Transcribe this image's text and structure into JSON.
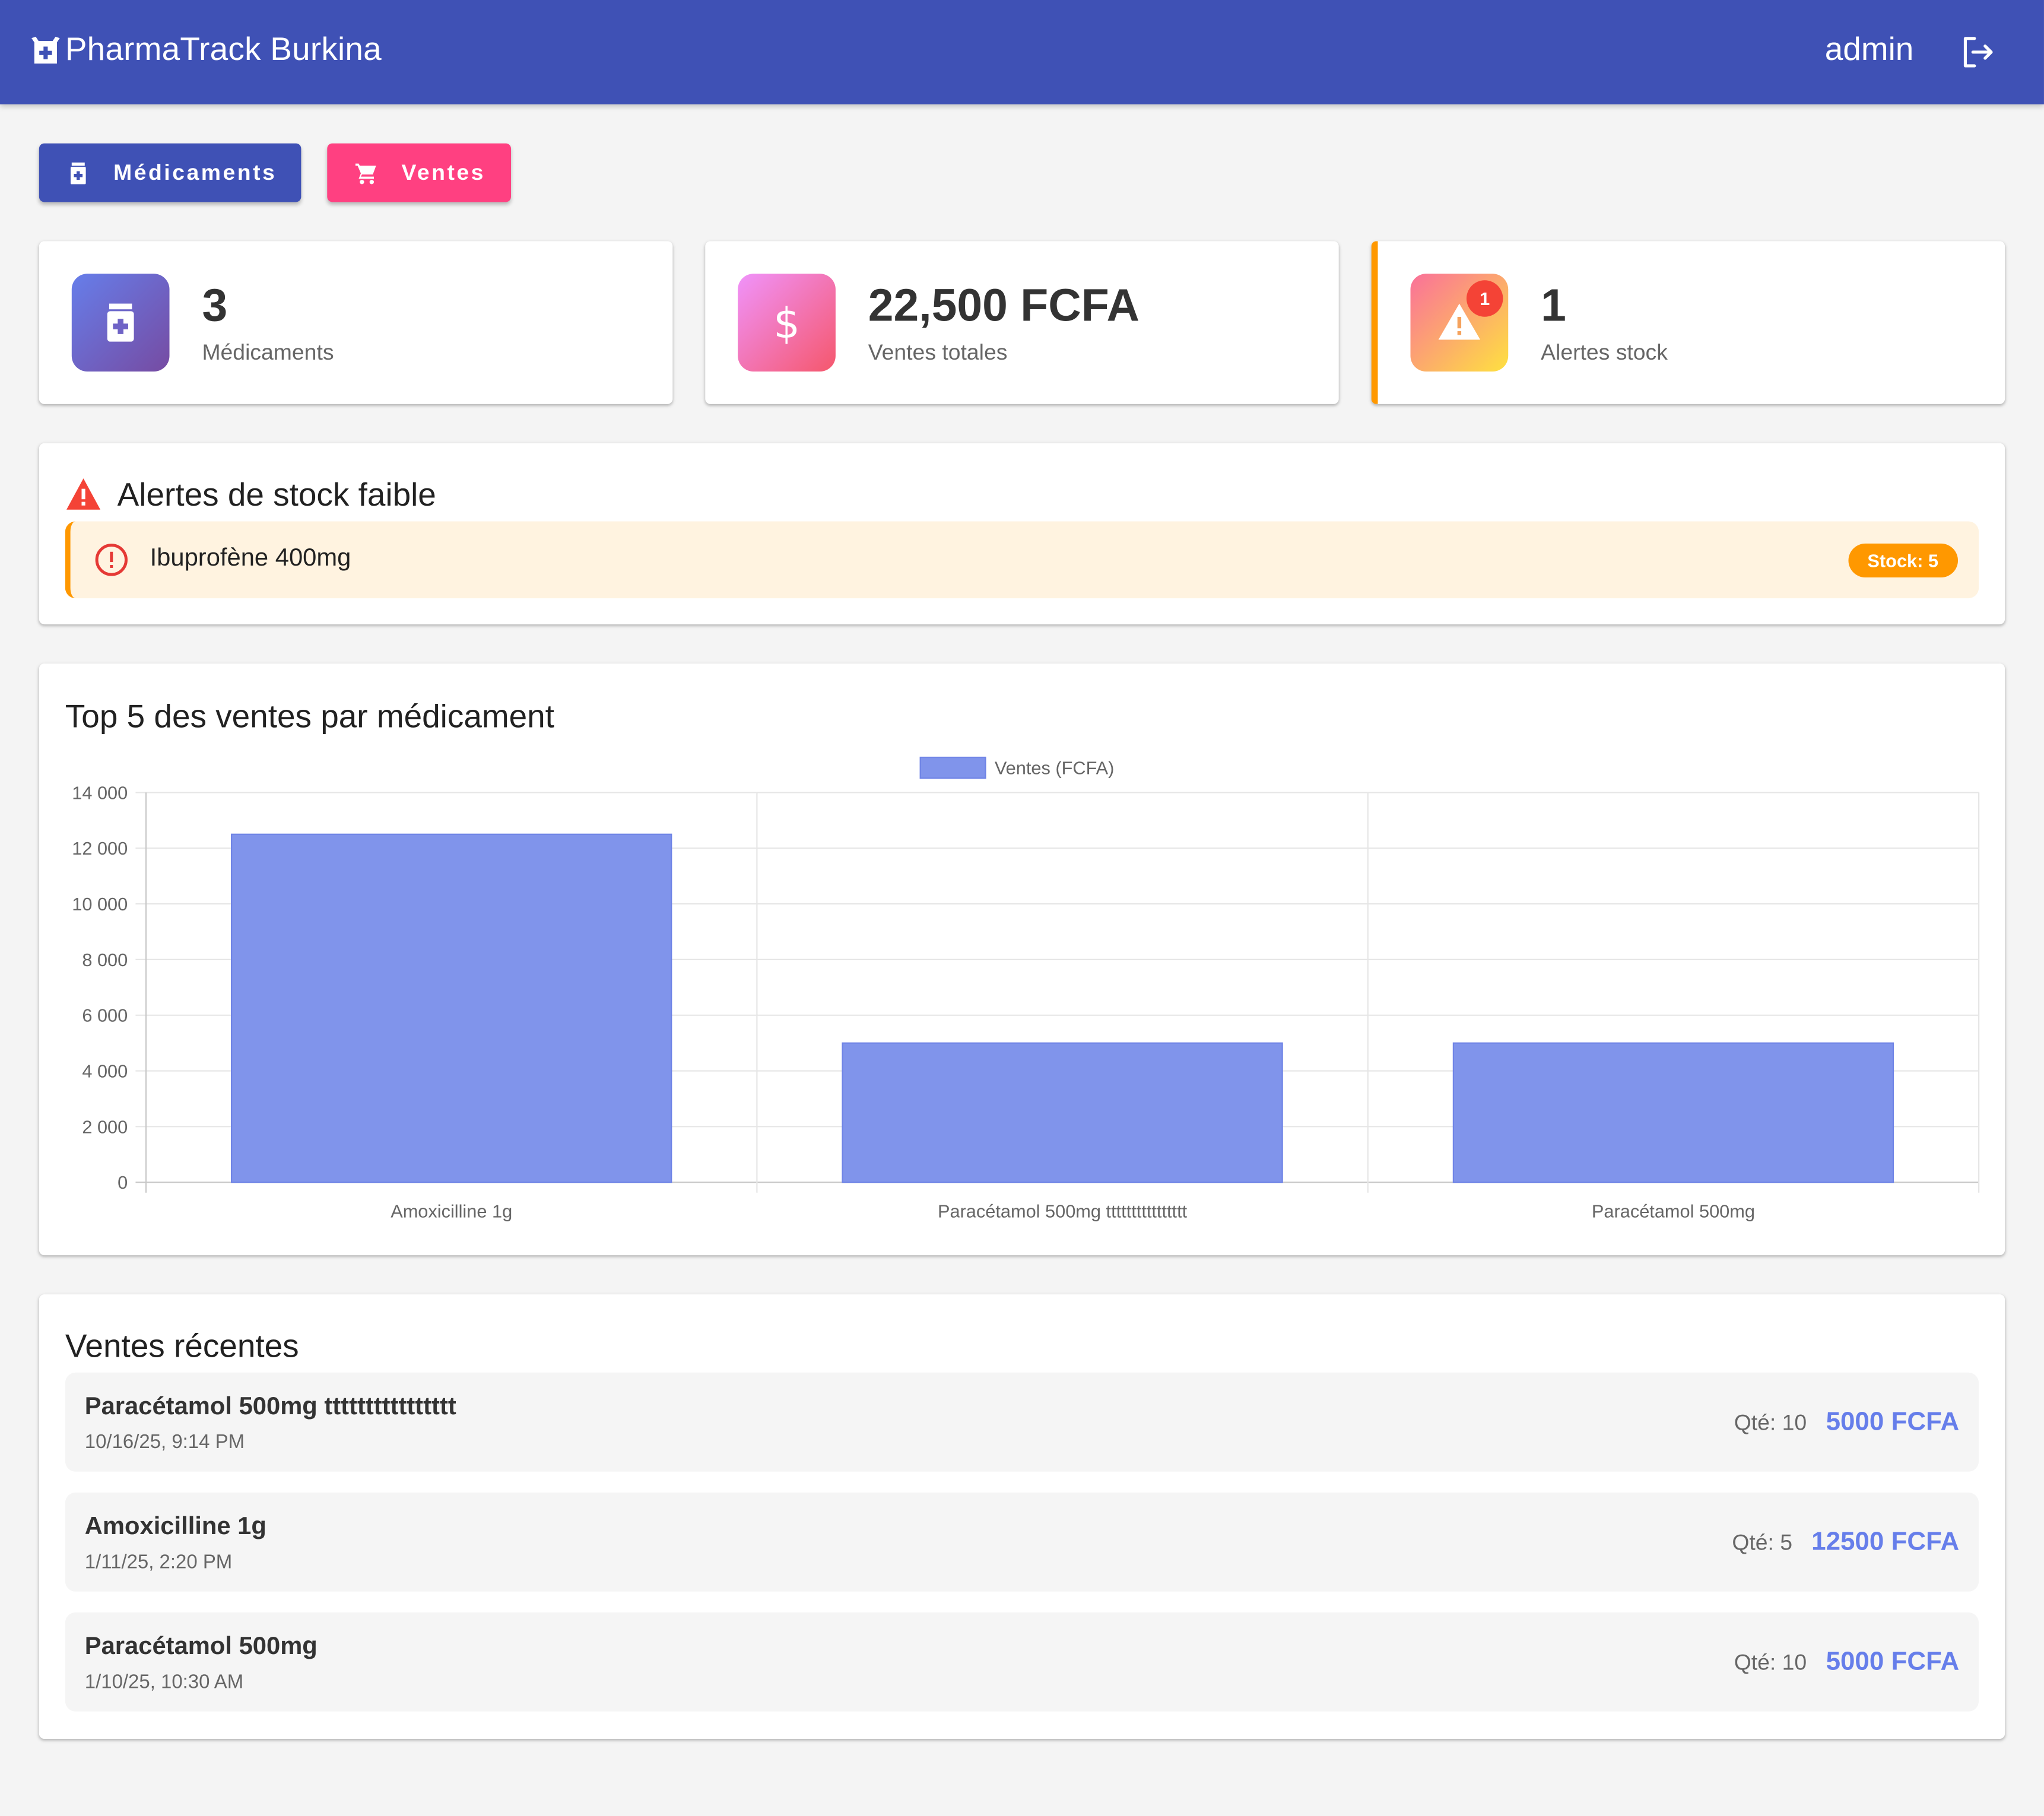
{
  "appbar": {
    "title": "PharmaTrack Burkina",
    "user": "admin",
    "logo_icon": "medication-icon",
    "logout_icon": "logout-icon",
    "color": "#3f51b5"
  },
  "nav": {
    "medicaments_label": "Médicaments",
    "ventes_label": "Ventes",
    "medicaments_color": "#3f51b5",
    "ventes_color": "#ff4081"
  },
  "stats": [
    {
      "value": "3",
      "label": "Médicaments",
      "icon": "medication-icon"
    },
    {
      "value": "22,500 FCFA",
      "label": "Ventes totales",
      "icon": "dollar-icon"
    },
    {
      "value": "1",
      "label": "Alertes stock",
      "icon": "warning-icon",
      "badge": "1",
      "accent": "#ff9800"
    }
  ],
  "alerts": {
    "title": "Alertes de stock faible",
    "items": [
      {
        "name": "Ibuprofène 400mg",
        "stock": "Stock: 5"
      }
    ]
  },
  "chart": {
    "title": "Top 5 des ventes par médicament"
  },
  "chart_data": {
    "type": "bar",
    "categories": [
      "Amoxicilline 1g",
      "Paracétamol 500mg tttttttttttttttt",
      "Paracétamol 500mg"
    ],
    "series": [
      {
        "name": "Ventes (FCFA)",
        "values": [
          12500,
          5000,
          5000
        ],
        "color": "#8094eb"
      }
    ],
    "ylim": [
      0,
      14000
    ],
    "yticks": [
      0,
      2000,
      4000,
      6000,
      8000,
      10000,
      12000,
      14000
    ],
    "ytick_labels": [
      "0",
      "2 000",
      "4 000",
      "6 000",
      "8 000",
      "10 000",
      "12 000",
      "14 000"
    ],
    "grid": true,
    "legend": "top-center",
    "xlabel": "",
    "ylabel": ""
  },
  "recent": {
    "title": "Ventes récentes",
    "items": [
      {
        "name": "Paracétamol 500mg tttttttttttttttt",
        "date": "10/16/25, 9:14 PM",
        "qty": "Qté: 10",
        "amount": "5000 FCFA"
      },
      {
        "name": "Amoxicilline 1g",
        "date": "1/11/25, 2:20 PM",
        "qty": "Qté: 5",
        "amount": "12500 FCFA"
      },
      {
        "name": "Paracétamol 500mg",
        "date": "1/10/25, 10:30 AM",
        "qty": "Qté: 10",
        "amount": "5000 FCFA"
      }
    ]
  }
}
